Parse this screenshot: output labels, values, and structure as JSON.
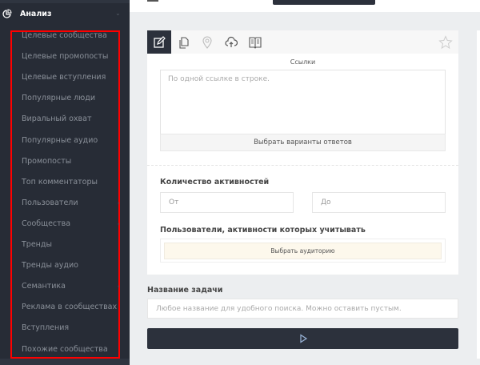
{
  "sidebar": {
    "section_title": "Анализ",
    "items": [
      {
        "label": "Целевые сообщества"
      },
      {
        "label": "Целевые промопосты"
      },
      {
        "label": "Целевые вступления"
      },
      {
        "label": "Популярные люди"
      },
      {
        "label": "Виральный охват"
      },
      {
        "label": "Популярные аудио"
      },
      {
        "label": "Промопосты"
      },
      {
        "label": "Топ комментаторы"
      },
      {
        "label": "Пользователи",
        "has_submenu": true
      },
      {
        "label": "Сообщества",
        "has_submenu": true
      },
      {
        "label": "Тренды"
      },
      {
        "label": "Тренды аудио"
      },
      {
        "label": "Семантика",
        "has_submenu": true
      },
      {
        "label": "Реклама в сообществах"
      },
      {
        "label": "Вступления"
      },
      {
        "label": "Похожие сообщества"
      }
    ],
    "highlight_color": "#ff0000"
  },
  "toolbar": {
    "tabs": [
      "edit-icon",
      "copy-icon",
      "location-pin-icon",
      "cloud-upload-icon",
      "book-icon"
    ],
    "active": "edit-icon",
    "favorite": "star-icon"
  },
  "form": {
    "links_label": "Ссылки",
    "links_placeholder": "По одной ссылке в строке.",
    "choose_answers": "Выбрать варианты ответов",
    "activity_count_label": "Количество активностей",
    "from_placeholder": "От",
    "to_placeholder": "До",
    "users_label": "Пользователи, активности которых учитывать",
    "choose_audience": "Выбрать аудиторию",
    "task_name_label": "Название задачи",
    "task_name_placeholder": "Любое название для удобного поиска. Можно оставить пустым.",
    "run_icon": "play-icon"
  },
  "colors": {
    "sidebar_bg": "#272c36",
    "dark_button": "#2c313c",
    "audience_bg": "#fdf8ec"
  }
}
